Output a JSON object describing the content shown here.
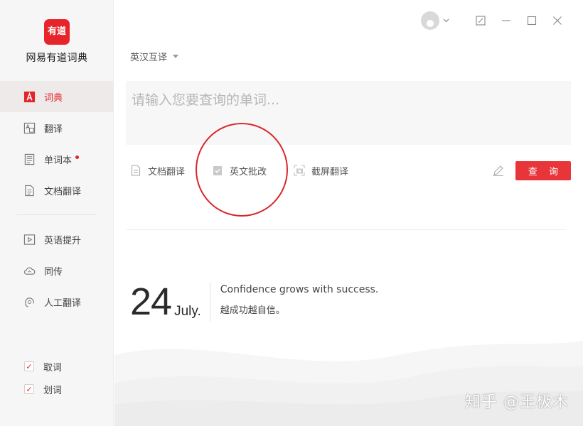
{
  "app": {
    "logo_text": "有道",
    "name": "网易有道词典"
  },
  "nav": {
    "primary": [
      {
        "label": "词典",
        "icon": "dict-icon",
        "active": true
      },
      {
        "label": "翻译",
        "icon": "translate-icon",
        "active": false
      },
      {
        "label": "单词本",
        "icon": "wordbook-icon",
        "active": false,
        "badge": "red-dot"
      },
      {
        "label": "文档翻译",
        "icon": "document-icon",
        "active": false
      }
    ],
    "secondary": [
      {
        "label": "英语提升",
        "icon": "play-icon"
      },
      {
        "label": "同传",
        "icon": "cloud-icon"
      },
      {
        "label": "人工翻译",
        "icon": "headset-icon"
      }
    ]
  },
  "footer": {
    "options": [
      {
        "label": "取词",
        "checked": true
      },
      {
        "label": "划词",
        "checked": true
      }
    ]
  },
  "mode": {
    "label": "英汉互译"
  },
  "search": {
    "placeholder": "请输入您要查询的单词..."
  },
  "toolbar": {
    "doc_translate": "文档翻译",
    "english_correction": "英文批改",
    "screenshot_translate": "截屏翻译",
    "query_button": "查 询"
  },
  "daily": {
    "day": "24",
    "month": "July.",
    "quote_en": "Confidence grows with success.",
    "quote_zh": "越成功越自信。"
  },
  "watermark": "知乎 @王极木",
  "colors": {
    "accent": "#e8353a",
    "sidebar_bg": "#f6f6f6",
    "annotation": "#d9262c"
  }
}
